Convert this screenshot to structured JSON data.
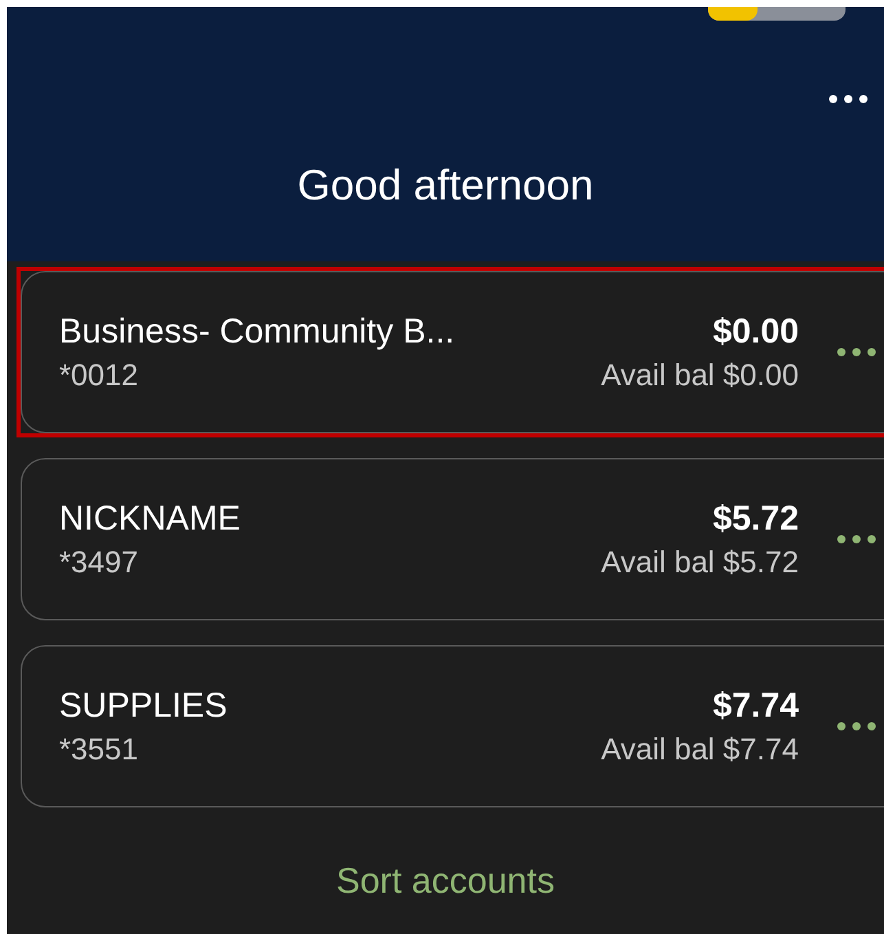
{
  "header": {
    "greeting": "Good afternoon"
  },
  "accounts": [
    {
      "name": "Business- Community B...",
      "number": "*0012",
      "balance": "$0.00",
      "available": "Avail bal $0.00",
      "highlighted": true
    },
    {
      "name": "NICKNAME",
      "number": "*3497",
      "balance": "$5.72",
      "available": "Avail bal $5.72",
      "highlighted": false
    },
    {
      "name": "SUPPLIES",
      "number": "*3551",
      "balance": "$7.74",
      "available": "Avail bal $7.74",
      "highlighted": false
    }
  ],
  "sort_link": "Sort accounts"
}
